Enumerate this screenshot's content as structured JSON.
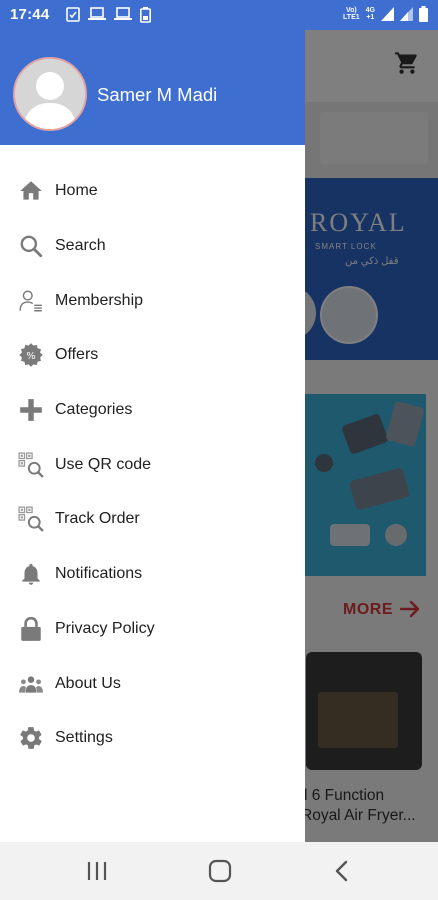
{
  "status_bar": {
    "time": "17:44",
    "net_top": "Vo)",
    "net_bottom": "LTE1",
    "net_type_top": "4G",
    "net_type_bottom": "+1",
    "icons": [
      "checkbox-notification-icon",
      "laptop-icon",
      "laptop-icon",
      "battery-saver-icon",
      "signal-icon",
      "signal-icon",
      "battery-icon"
    ]
  },
  "drawer": {
    "user_name": "Samer M Madi",
    "header_color": "#3d6ed0",
    "items": [
      {
        "label": "Home",
        "icon": "home-icon"
      },
      {
        "label": "Search",
        "icon": "search-icon"
      },
      {
        "label": "Membership",
        "icon": "membership-icon"
      },
      {
        "label": "Offers",
        "icon": "offers-percent-icon"
      },
      {
        "label": "Categories",
        "icon": "plus-icon"
      },
      {
        "label": "Use QR code",
        "icon": "qr-search-icon"
      },
      {
        "label": "Track Order",
        "icon": "qr-search-icon"
      },
      {
        "label": "Notifications",
        "icon": "bell-icon"
      },
      {
        "label": "Privacy Policy",
        "icon": "lock-icon"
      },
      {
        "label": "About Us",
        "icon": "group-icon"
      },
      {
        "label": "Settings",
        "icon": "gear-icon"
      }
    ]
  },
  "background": {
    "banner_brand": "ROYAL",
    "banner_sub": "SMART LOCK",
    "banner_arabic": "قفل ذكي من",
    "more_label": "MORE",
    "product_title_line1": "l 6 Function",
    "product_title_line2": "Royal Air Fryer..."
  },
  "accent_color": "#d9383a"
}
